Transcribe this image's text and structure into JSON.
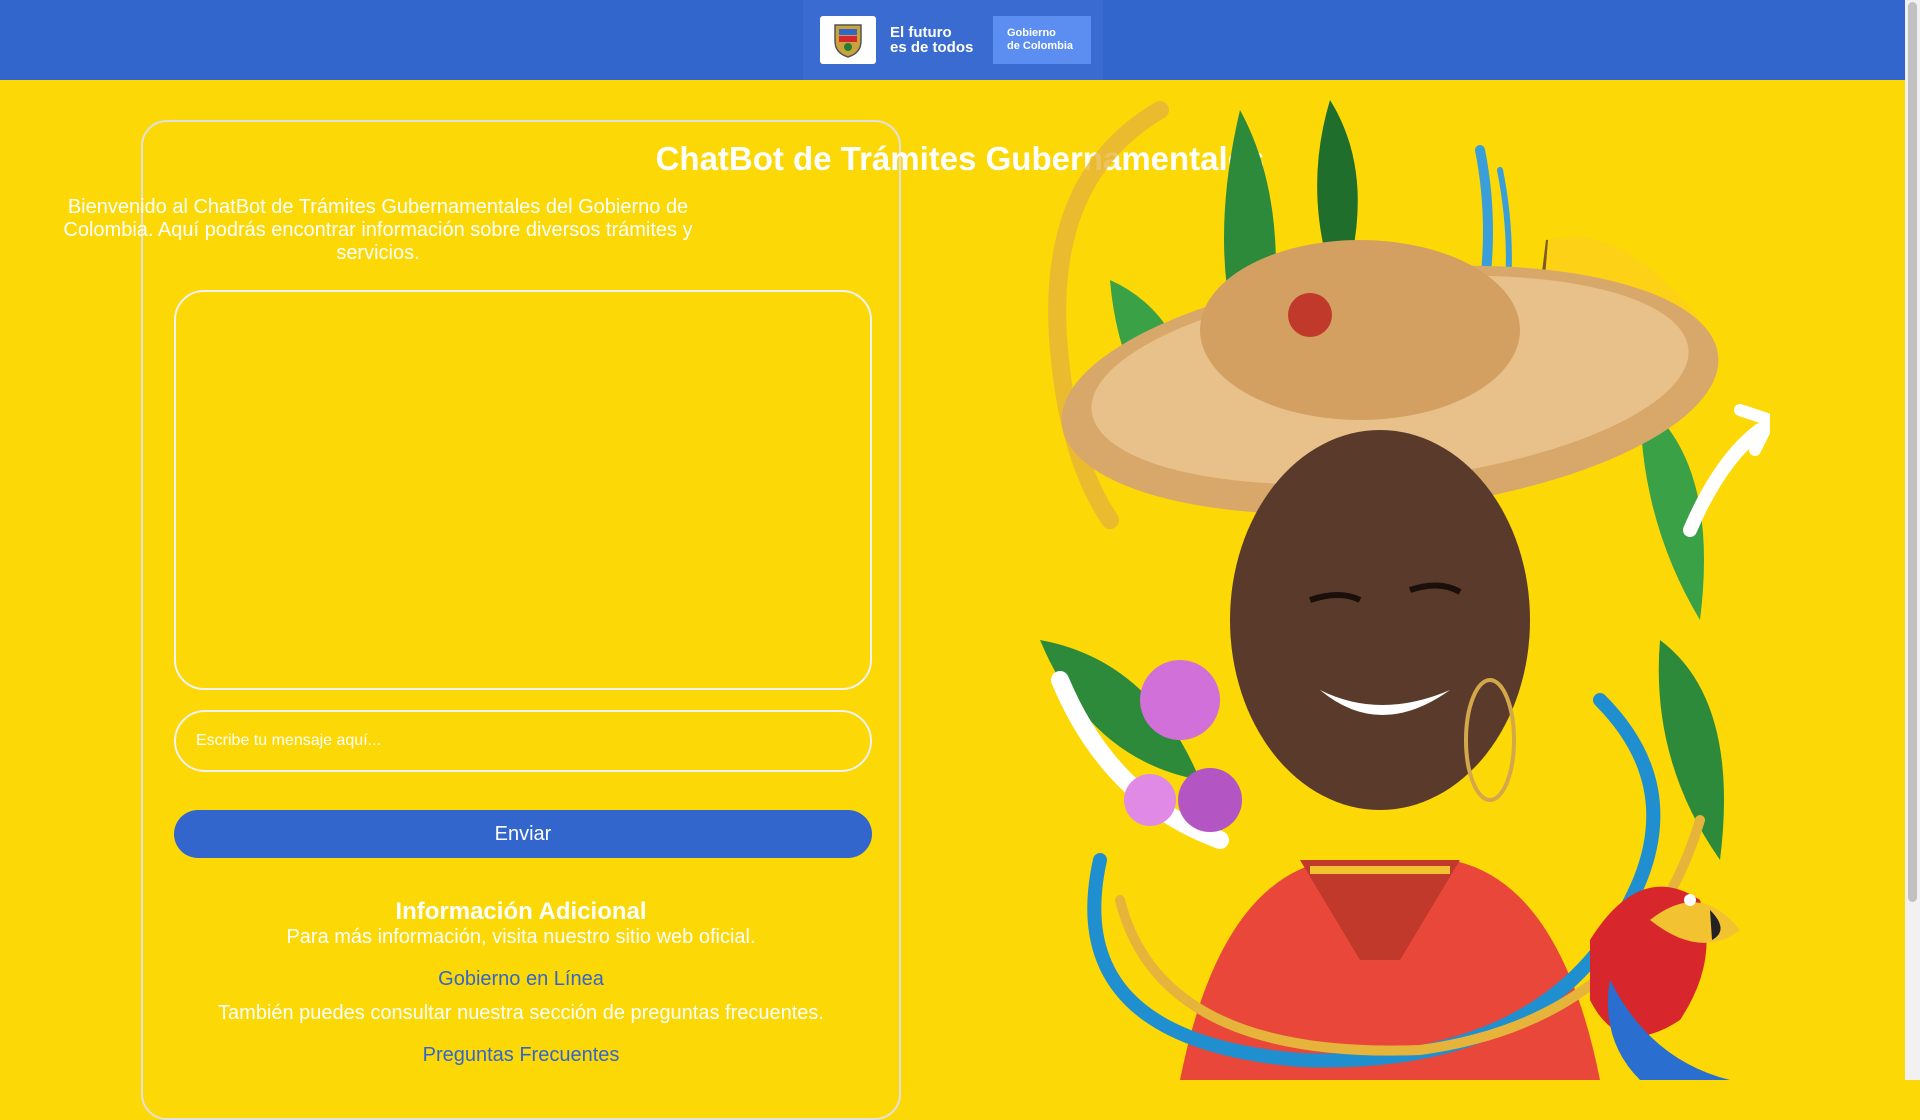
{
  "header": {
    "logo_line1": "El futuro",
    "logo_line2": "es de todos",
    "gov_line1": "Gobierno",
    "gov_line2": "de Colombia"
  },
  "main": {
    "title": "ChatBot de Trámites Gubernamentales",
    "intro": "Bienvenido al ChatBot de Trámites Gubernamentales del Gobierno de Colombia. Aquí podrás encontrar información sobre diversos trámites y servicios.",
    "input_placeholder": "Escribe tu mensaje aquí...",
    "send_label": "Enviar"
  },
  "info": {
    "title": "Información Adicional",
    "text1": "Para más información, visita nuestro sitio web oficial.",
    "link1": "Gobierno en Línea",
    "text2": "También puedes consultar nuestra sección de preguntas frecuentes.",
    "link2": "Preguntas Frecuentes"
  },
  "colors": {
    "background": "#fcd807",
    "primary": "#3366cc"
  }
}
